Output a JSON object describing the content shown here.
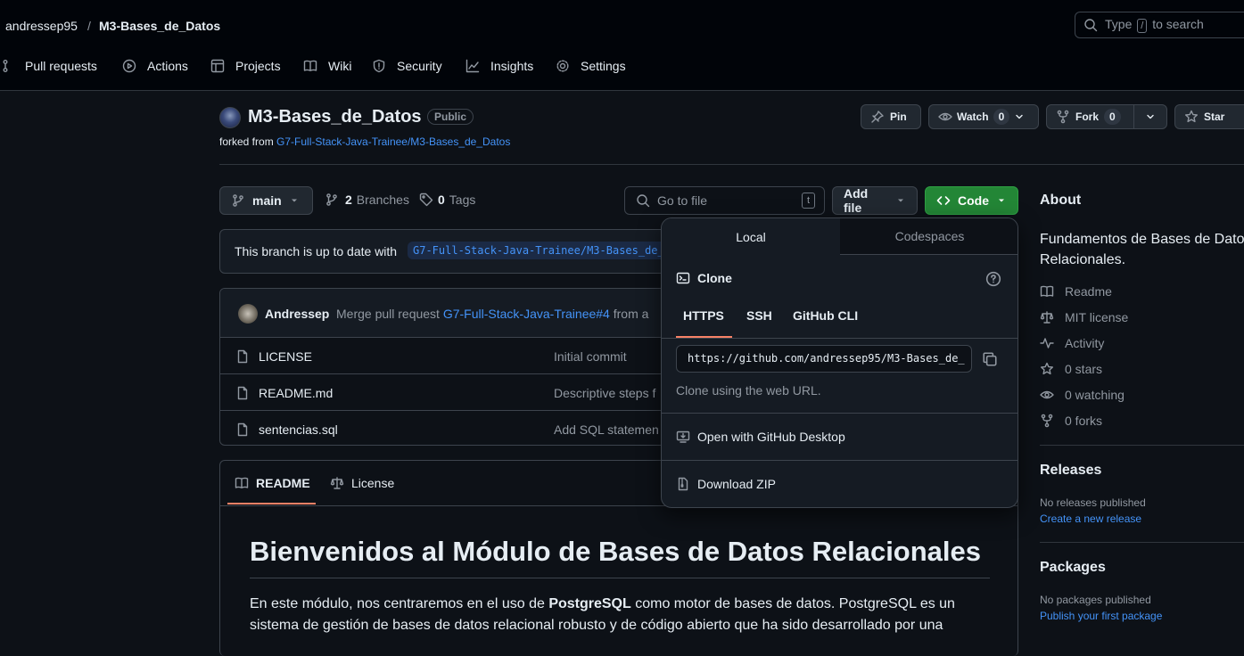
{
  "header": {
    "owner": "andressep95",
    "separator": "/",
    "repo": "M3-Bases_de_Datos",
    "search_prefix": "Type",
    "search_key": "/",
    "search_suffix": "to search"
  },
  "nav": {
    "pull_requests": "Pull requests",
    "actions": "Actions",
    "projects": "Projects",
    "wiki": "Wiki",
    "security": "Security",
    "insights": "Insights",
    "settings": "Settings"
  },
  "repo": {
    "title": "M3-Bases_de_Datos",
    "visibility": "Public",
    "forked_prefix": "forked from",
    "forked_from": "G7-Full-Stack-Java-Trainee/M3-Bases_de_Datos",
    "pin": "Pin",
    "watch": "Watch",
    "watch_count": "0",
    "fork": "Fork",
    "fork_count": "0",
    "star": "Star"
  },
  "toolbar": {
    "branch": "main",
    "branches_count": "2",
    "branches_label": "Branches",
    "tags_count": "0",
    "tags_label": "Tags",
    "go_to_file": "Go to file",
    "go_to_file_key": "t",
    "add_file": "Add file",
    "code": "Code"
  },
  "branch_status": {
    "text": "This branch is up to date with",
    "ref": "G7-Full-Stack-Java-Trainee/M3-Bases_de_"
  },
  "commit": {
    "author": "Andressep",
    "message": "Merge pull request",
    "pr_link": "G7-Full-Stack-Java-Trainee#4",
    "suffix": "from a"
  },
  "files": [
    {
      "name": "LICENSE",
      "message": "Initial commit"
    },
    {
      "name": "README.md",
      "message": "Descriptive steps f"
    },
    {
      "name": "sentencias.sql",
      "message": "Add SQL statemen"
    }
  ],
  "readme": {
    "tab_readme": "README",
    "tab_license": "License",
    "heading": "Bienvenidos al Módulo de Bases de Datos Relacionales",
    "p_prefix": "En este módulo, nos centraremos en el uso de",
    "p_bold": "PostgreSQL",
    "p_suffix": "como motor de bases de datos. PostgreSQL es un",
    "p_line2": "sistema de gestión de bases de datos relacional robusto y de código abierto que ha sido desarrollado por una"
  },
  "code_dropdown": {
    "tab_local": "Local",
    "tab_codespaces": "Codespaces",
    "clone_title": "Clone",
    "tabs": [
      "HTTPS",
      "SSH",
      "GitHub CLI"
    ],
    "url": "https://github.com/andressep95/M3-Bases_de_",
    "hint": "Clone using the web URL.",
    "open_desktop": "Open with GitHub Desktop",
    "download_zip": "Download ZIP"
  },
  "about": {
    "title": "About",
    "description_line1": "Fundamentos de Bases de Datos",
    "description_line2": "Relacionales.",
    "readme": "Readme",
    "license": "MIT license",
    "activity": "Activity",
    "stars": "0 stars",
    "watching": "0 watching",
    "forks": "0 forks"
  },
  "releases": {
    "title": "Releases",
    "none": "No releases published",
    "create": "Create a new release"
  },
  "packages": {
    "title": "Packages",
    "none": "No packages published",
    "publish": "Publish your first package"
  },
  "colors": {
    "background": "#0d1117",
    "header": "#010409",
    "accent_link": "#4493f8",
    "code_button": "#238636",
    "active_tab_underline": "#f78166"
  }
}
